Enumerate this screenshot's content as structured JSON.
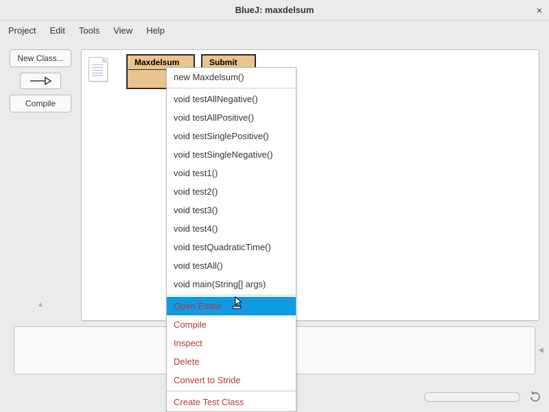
{
  "title": "BlueJ:  maxdelsum",
  "menubar": [
    "Project",
    "Edit",
    "Tools",
    "View",
    "Help"
  ],
  "sidebar": {
    "new_class": "New Class...",
    "compile": "Compile"
  },
  "classes": [
    {
      "name": "Maxdelsum"
    },
    {
      "name": "Submit"
    }
  ],
  "context_menu": {
    "methods": [
      "new Maxdelsum()",
      "void testAllNegative()",
      "void testAllPositive()",
      "void testSinglePositive()",
      "void testSingleNegative()",
      "void test1()",
      "void test2()",
      "void test3()",
      "void test4()",
      "void testQuadraticTime()",
      "void testAll()",
      "void main(String[] args)"
    ],
    "open_editor": "Open Editor",
    "compile": "Compile",
    "inspect": "Inspect",
    "delete": "Delete",
    "convert": "Convert to Stride",
    "create_test": "Create Test Class"
  }
}
